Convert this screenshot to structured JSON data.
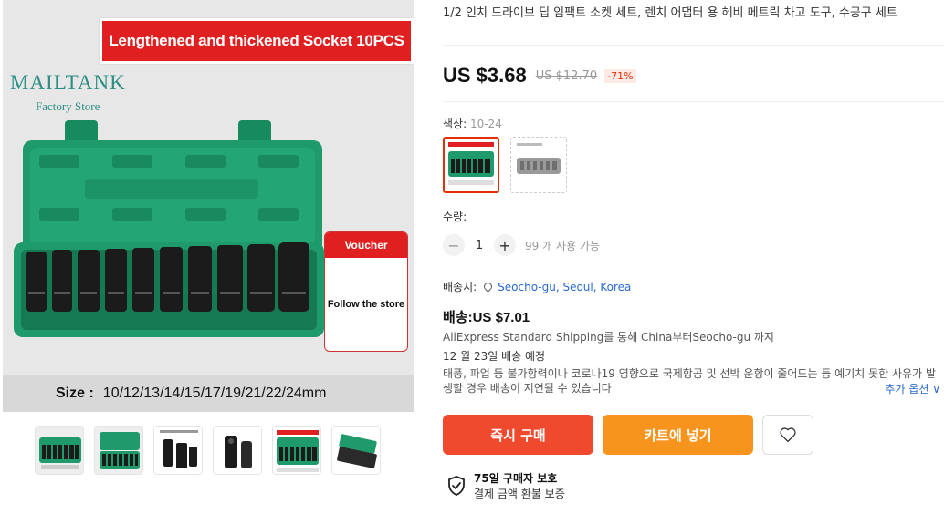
{
  "gallery": {
    "banner_text": "Lengthened and thickened Socket 10PCS",
    "brand_name": "MAILTANK",
    "brand_sub": "Factory Store",
    "voucher_title": "Voucher",
    "voucher_body": "Follow the store",
    "size_label": "Size :",
    "size_values": "10/12/13/14/15/17/19/21/22/24mm",
    "thumbnail_count": 6
  },
  "product": {
    "title": "1/2 인치 드라이브 딥 임팩트 소켓 세트, 렌치 어댑터 용 헤비 메트릭 차고 도구, 수공구 세트",
    "price": "US $3.68",
    "original_price": "US $12.70",
    "discount": "-71%"
  },
  "color": {
    "label": "색상:",
    "value": "10-24"
  },
  "quantity": {
    "label": "수량:",
    "minus": "−",
    "value": "1",
    "plus": "+",
    "available": "99 개 사용 가능"
  },
  "shipping": {
    "to_label": "배송지:",
    "location": "Seocho-gu, Seoul, Korea",
    "cost": "배송:US $7.01",
    "via": "AliExpress Standard Shipping를 통해 China부터Seocho-gu 까지",
    "delivery": "12 월 23일 배송 예정",
    "notice": "태풍, 파업 등 불가항력이나 코로나19 영향으로 국제항공 및 선박 운항이 줄어드는 등 예기치 못한 사유가 발생할 경우 배송이 지연될 수 있습니다",
    "more_options": "추가 옵션 ∨"
  },
  "actions": {
    "buy_now": "즉시 구매",
    "add_to_cart": "카트에 넣기",
    "wishlist_icon": "heart-icon"
  },
  "protection": {
    "title": "75일 구매자 보호",
    "subtitle": "결제 금액 환불 보증",
    "icon": "shield-check-icon"
  },
  "colors": {
    "accent": "#e62e04",
    "buy_now": "#ef4a2e",
    "cart": "#f7941d",
    "link": "#2a6bd0",
    "case_green": "#1f9a6b"
  }
}
